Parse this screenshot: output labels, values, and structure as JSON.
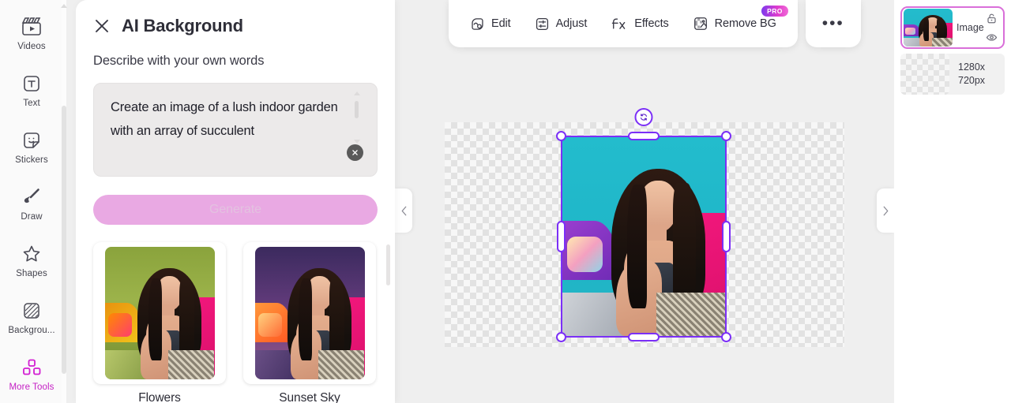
{
  "sidebar": {
    "items": [
      {
        "label": "Videos",
        "icon": "clapperboard-icon",
        "active": false
      },
      {
        "label": "Text",
        "icon": "text-t-icon",
        "active": false
      },
      {
        "label": "Stickers",
        "icon": "sticker-icon",
        "active": false
      },
      {
        "label": "Draw",
        "icon": "brush-icon",
        "active": false
      },
      {
        "label": "Shapes",
        "icon": "star-icon",
        "active": false
      },
      {
        "label": "Backgrou...",
        "icon": "background-hatch-icon",
        "active": false
      },
      {
        "label": "More Tools",
        "icon": "grid-blocks-icon",
        "active": true
      }
    ]
  },
  "panel": {
    "title": "AI Background",
    "close_icon": "close-icon",
    "describe_label": "Describe with your own words",
    "prompt_value": "Create an image of a lush indoor garden with an array of succulent",
    "prompt_placeholder": "Describe with your own words",
    "clear_icon": "clear-x-icon",
    "generate_label": "Generate",
    "presets": [
      {
        "label": "Flowers",
        "style": "flowers"
      },
      {
        "label": "Sunset Sky",
        "style": "sunset"
      }
    ]
  },
  "toolbar": {
    "buttons": [
      {
        "label": "Edit",
        "icon": "edit-image-icon",
        "badge": ""
      },
      {
        "label": "Adjust",
        "icon": "sliders-icon",
        "badge": ""
      },
      {
        "label": "Effects",
        "icon": "fx-icon",
        "badge": ""
      },
      {
        "label": "Remove BG",
        "icon": "remove-bg-icon",
        "badge": "PRO"
      }
    ],
    "more_label": "•••"
  },
  "canvas": {
    "prev_arrow": "chevron-left-icon",
    "next_arrow": "chevron-right-icon",
    "rotate_icon": "rotate-icon"
  },
  "layers": {
    "image_layer": {
      "name": "Image",
      "lock_icon": "unlock-icon",
      "visibility_icon": "eye-icon"
    },
    "background_layer": {
      "size_line_1": "1280x",
      "size_line_2": "720px"
    }
  },
  "colors": {
    "accent_purple": "#7b2ff7",
    "accent_magenta": "#d21fd2",
    "generate_pink": "#e9a9e3",
    "pro_badge_start": "#7c3aed",
    "pro_badge_end": "#f06ad6",
    "canvas_bg": "#efefef"
  }
}
